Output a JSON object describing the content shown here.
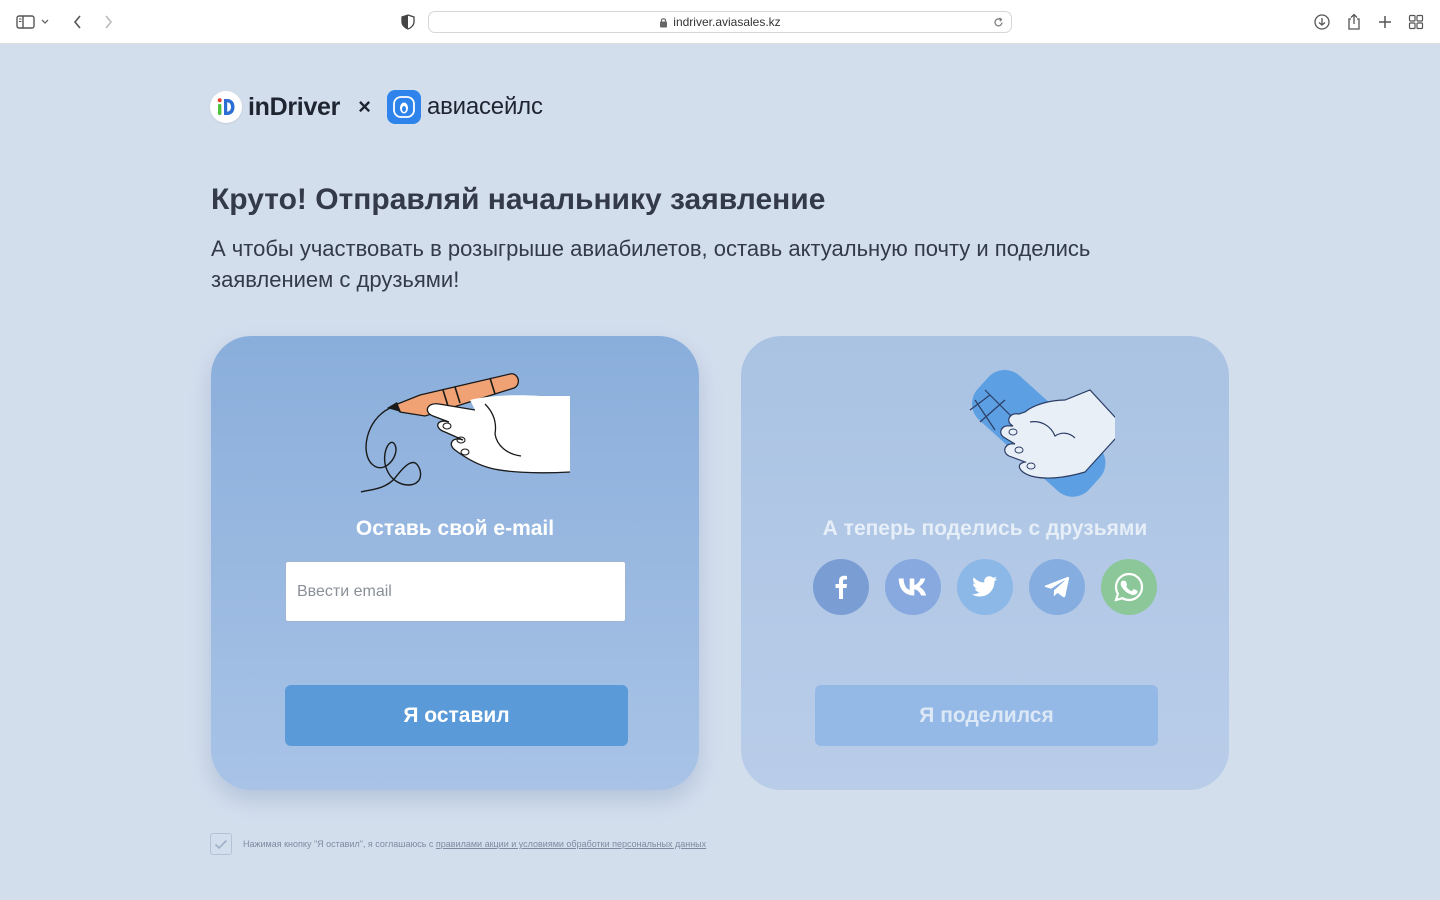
{
  "browser": {
    "url": "indriver.aviasales.kz"
  },
  "header": {
    "brand_left": "inDriver",
    "separator": "×",
    "brand_right": "авиасейлс"
  },
  "hero": {
    "title": "Круто! Отправляй начальнику заявление",
    "subtitle": "А чтобы участвовать в розыгрыше авиабилетов, оставь актуальную почту и поделись заявлением с друзьями!"
  },
  "email_card": {
    "title": "Оставь свой e-mail",
    "input_placeholder": "Ввести email",
    "input_value": "",
    "button_label": "Я оставил"
  },
  "share_card": {
    "title": "А теперь поделись с друзьями",
    "socials": [
      {
        "name": "facebook",
        "icon": "facebook-icon",
        "color": "#7a9dd3"
      },
      {
        "name": "vk",
        "icon": "vk-icon",
        "color": "#87a9df"
      },
      {
        "name": "twitter",
        "icon": "twitter-icon",
        "color": "#8cb8e8"
      },
      {
        "name": "telegram",
        "icon": "telegram-icon",
        "color": "#86ade0"
      },
      {
        "name": "whatsapp",
        "icon": "whatsapp-icon",
        "color": "#8cc79a"
      }
    ],
    "button_label": "Я поделился"
  },
  "consent": {
    "checked": true,
    "text": "Нажимая кнопку \"Я оставил\", я соглашаюсь с ",
    "link_text": "правилами акции и условиями обработки персональных данных"
  },
  "colors": {
    "page_bg": "#d3deed",
    "primary_button": "#5b9ad8",
    "accent": "#2e84ea"
  }
}
